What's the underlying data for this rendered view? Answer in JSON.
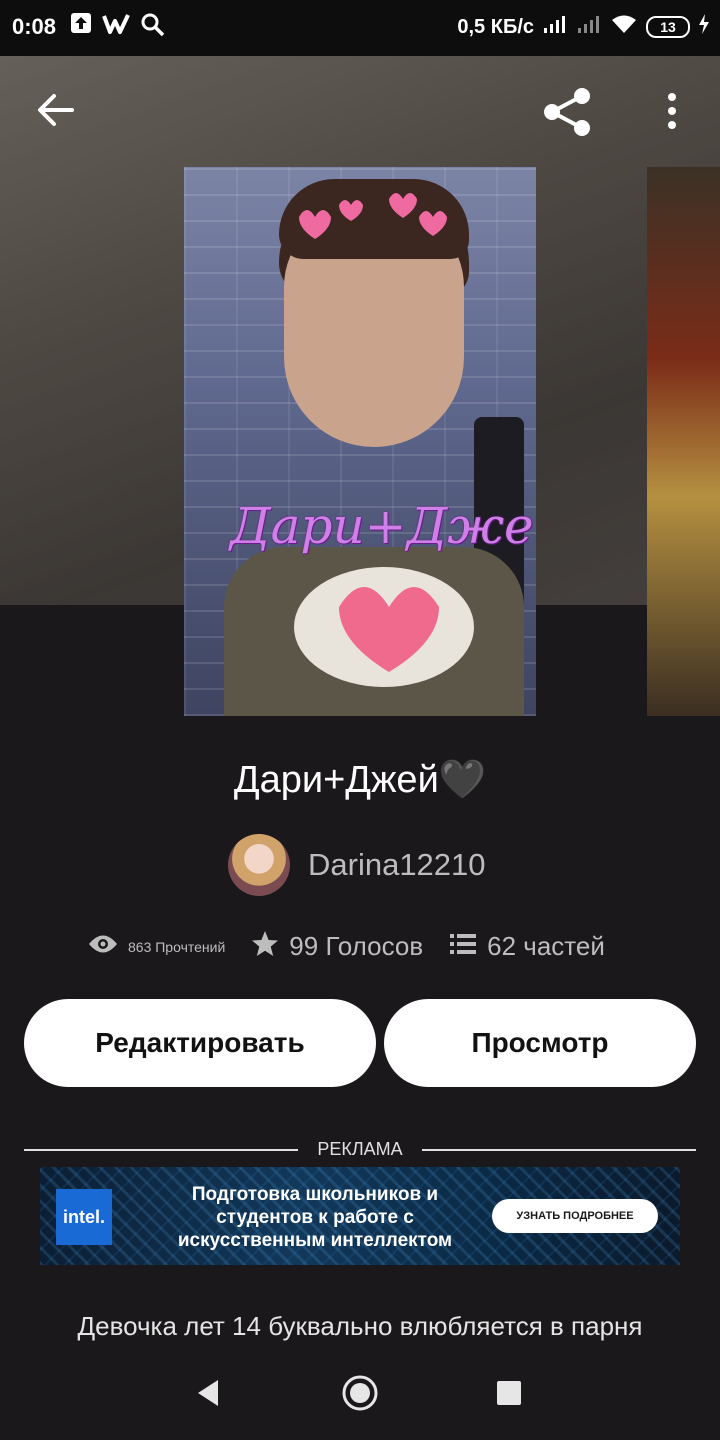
{
  "status_bar": {
    "time": "0:08",
    "network_speed": "0,5 КБ/с",
    "battery": "13"
  },
  "story": {
    "cover_overlay_text": "Дари+Джей",
    "title": "Дари+Джей",
    "title_emoji": "🖤",
    "author": "Darina12210",
    "reads": "863 Прочтений",
    "votes": "99 Голосов",
    "parts": "62 частей",
    "description": "Девочка лет 14 буквально влюбляется в парня"
  },
  "actions": {
    "edit_label": "Редактировать",
    "view_label": "Просмотр"
  },
  "ad": {
    "label": "РЕКЛАМА",
    "brand": "intel.",
    "text": "Подготовка школьников и студентов к работе с искусственным интеллектом",
    "cta": "УЗНАТЬ ПОДРОБНЕЕ"
  },
  "colors": {
    "background": "#1a181a",
    "button_bg": "#ffffff",
    "muted_text": "#bdbdbd",
    "cover_title": "#d07ee8"
  },
  "icons": [
    "back-arrow-icon",
    "share-icon",
    "more-vert-icon",
    "eye-icon",
    "star-icon",
    "list-icon",
    "nav-back-icon",
    "nav-home-icon",
    "nav-recents-icon"
  ]
}
